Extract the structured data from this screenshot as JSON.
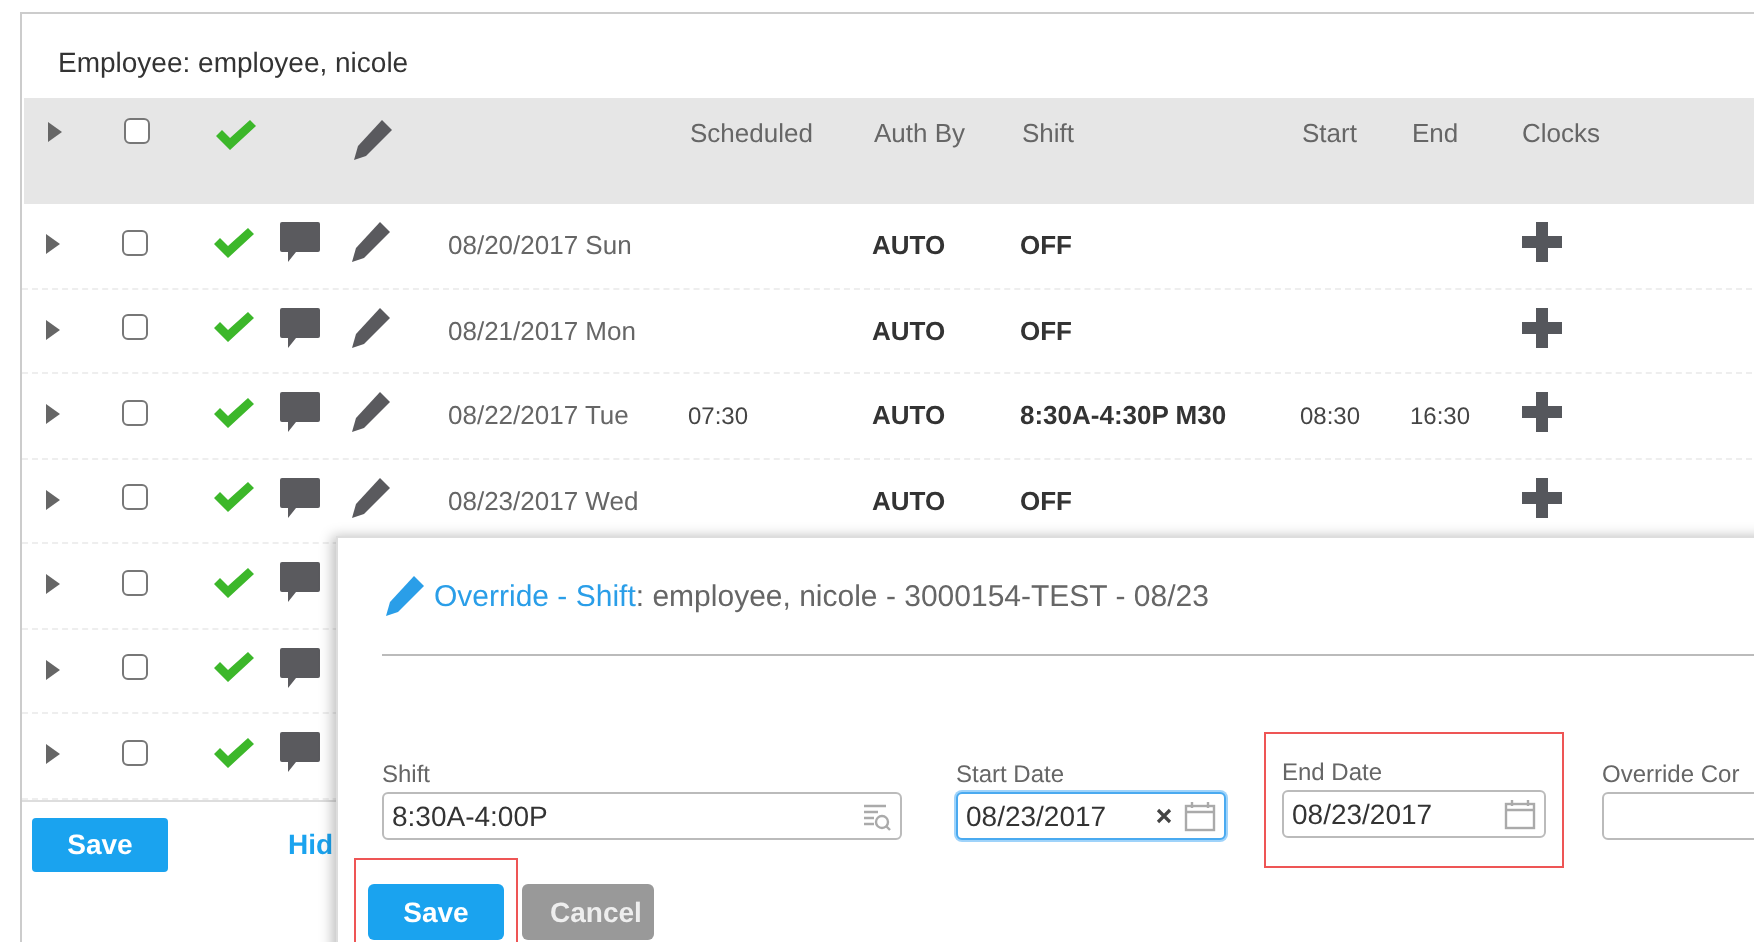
{
  "employee_header": "Employee: employee, nicole",
  "table": {
    "header": {
      "checked": false,
      "columns": [
        "Scheduled",
        "Auth By",
        "Shift",
        "Start",
        "End",
        "Clocks"
      ]
    },
    "rows": [
      {
        "kind": "full",
        "checked": false,
        "date": "08/20/2017 Sun",
        "auth_by": "AUTO",
        "shift": "OFF"
      },
      {
        "kind": "full",
        "checked": false,
        "date": "08/21/2017 Mon",
        "auth_by": "AUTO",
        "shift": "OFF"
      },
      {
        "kind": "full",
        "checked": false,
        "date": "08/22/2017 Tue",
        "scheduled": "07:30",
        "auth_by": "AUTO",
        "shift": "8:30A-4:30P M30",
        "start": "08:30",
        "end": "16:30"
      },
      {
        "kind": "full",
        "checked": false,
        "date": "08/23/2017 Wed",
        "auth_by": "AUTO",
        "shift": "OFF"
      },
      {
        "kind": "partial",
        "checked": false
      },
      {
        "kind": "partial",
        "checked": false
      },
      {
        "kind": "partial",
        "checked": false
      }
    ]
  },
  "footer": {
    "save": "Save",
    "link": "Hid"
  },
  "dialog": {
    "title_prefix": "Override - Shift",
    "title_rest": ": employee, nicole - 3000154-TEST - 08/23",
    "fields": [
      {
        "kind": "lookup",
        "label": "Shift",
        "value": "8:30A-4:00P",
        "focused": false,
        "highlighted": false
      },
      {
        "kind": "date",
        "label": "Start Date",
        "value": "08/23/2017",
        "clearable": true,
        "focused": true,
        "highlighted": false
      },
      {
        "kind": "date",
        "label": "End Date",
        "value": "08/23/2017",
        "clearable": false,
        "focused": false,
        "highlighted": true
      },
      {
        "kind": "text",
        "label": "Override Cor",
        "focused": false,
        "highlighted": false
      }
    ],
    "buttons": [
      {
        "kind": "primary",
        "label": "Save",
        "highlighted": true
      },
      {
        "kind": "secondary",
        "label": "Cancel",
        "highlighted": false
      }
    ]
  }
}
